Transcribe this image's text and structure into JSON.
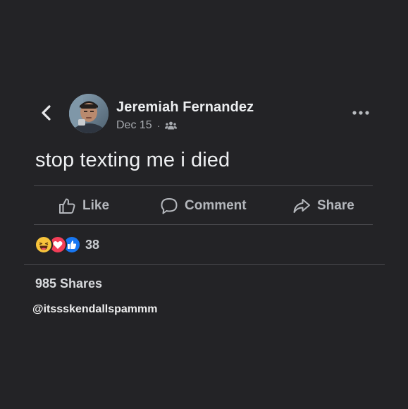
{
  "post": {
    "author": "Jeremiah Fernandez",
    "date": "Dec 15",
    "separator": "·",
    "audience_icon": "friends-icon",
    "text": "stop texting me i died"
  },
  "actions": {
    "like": "Like",
    "comment": "Comment",
    "share": "Share"
  },
  "reactions": {
    "icons": [
      "haha-reaction",
      "love-reaction",
      "like-reaction"
    ],
    "count": "38"
  },
  "shares": "985 Shares",
  "watermark": "@itssskendallspammm",
  "colors": {
    "background": "#232326",
    "text": "#eceef0",
    "muted": "#a8abb0",
    "like_blue": "#1877f2",
    "love_red": "#f33e58",
    "haha_yellow": "#f7c33b"
  }
}
